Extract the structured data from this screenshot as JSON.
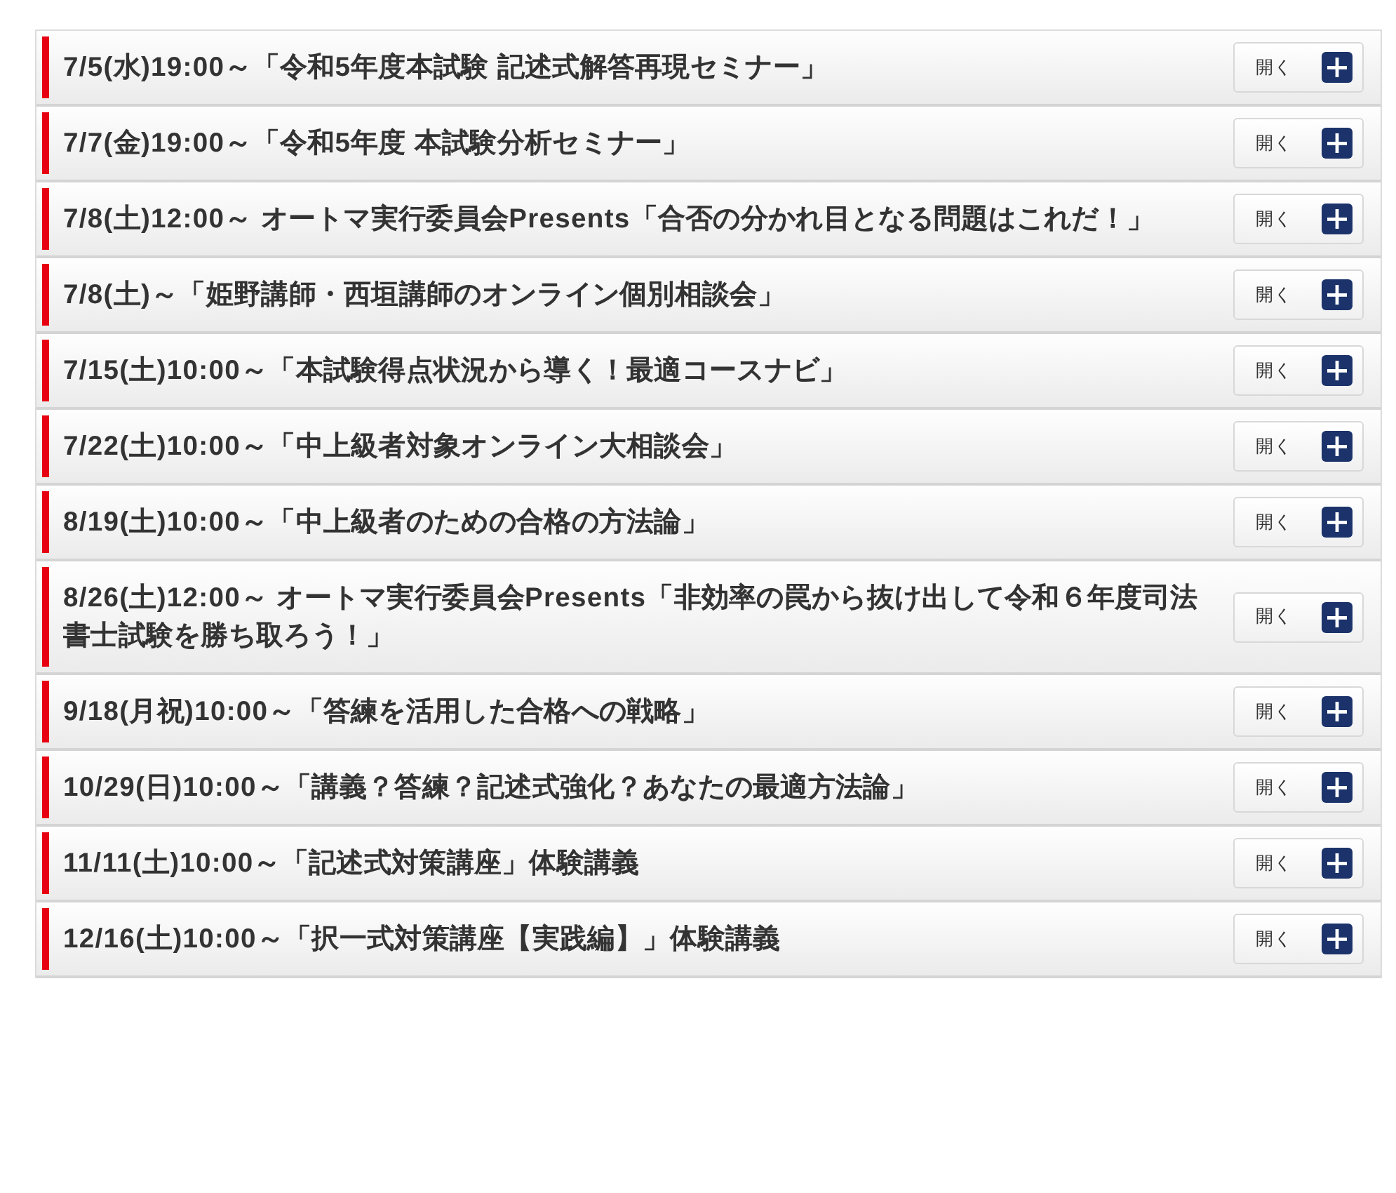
{
  "events": [
    {
      "title": "7/5(水)19:00～「令和5年度本試験 記述式解答再現セミナー」",
      "button": "開く",
      "expanded": false
    },
    {
      "title": "7/7(金)19:00～「令和5年度 本試験分析セミナー」",
      "button": "開く",
      "expanded": false
    },
    {
      "title": "7/8(土)12:00～ オートマ実行委員会Presents「合否の分かれ目となる問題はこれだ！」",
      "button": "開く",
      "expanded": false
    },
    {
      "title": "7/8(土)～「姫野講師・西垣講師のオンライン個別相談会」",
      "button": "開く",
      "expanded": false
    },
    {
      "title": "7/15(土)10:00～「本試験得点状況から導く！最適コースナビ」",
      "button": "開く",
      "expanded": false
    },
    {
      "title": "7/22(土)10:00～「中上級者対象オンライン大相談会」",
      "button": "開く",
      "expanded": false
    },
    {
      "title": "8/19(土)10:00～「中上級者のための合格の方法論」",
      "button": "開く",
      "expanded": false
    },
    {
      "title": "8/26(土)12:00～ オートマ実行委員会Presents「非効率の罠から抜け出して令和６年度司法書士試験を勝ち取ろう！」",
      "button": "開く",
      "expanded": false
    },
    {
      "title": "9/18(月祝)10:00～「答練を活用した合格への戦略」",
      "button": "開く",
      "expanded": false
    },
    {
      "title": "10/29(日)10:00～「講義？答練？記述式強化？あなたの最適方法論」",
      "button": "開く",
      "expanded": false
    },
    {
      "title": "11/11(土)10:00～「記述式対策講座」体験講義",
      "button": "開く",
      "expanded": false
    },
    {
      "title": "12/16(土)10:00～「択一式対策講座【実践編】」体験講義",
      "button": "開く",
      "expanded": false
    }
  ]
}
